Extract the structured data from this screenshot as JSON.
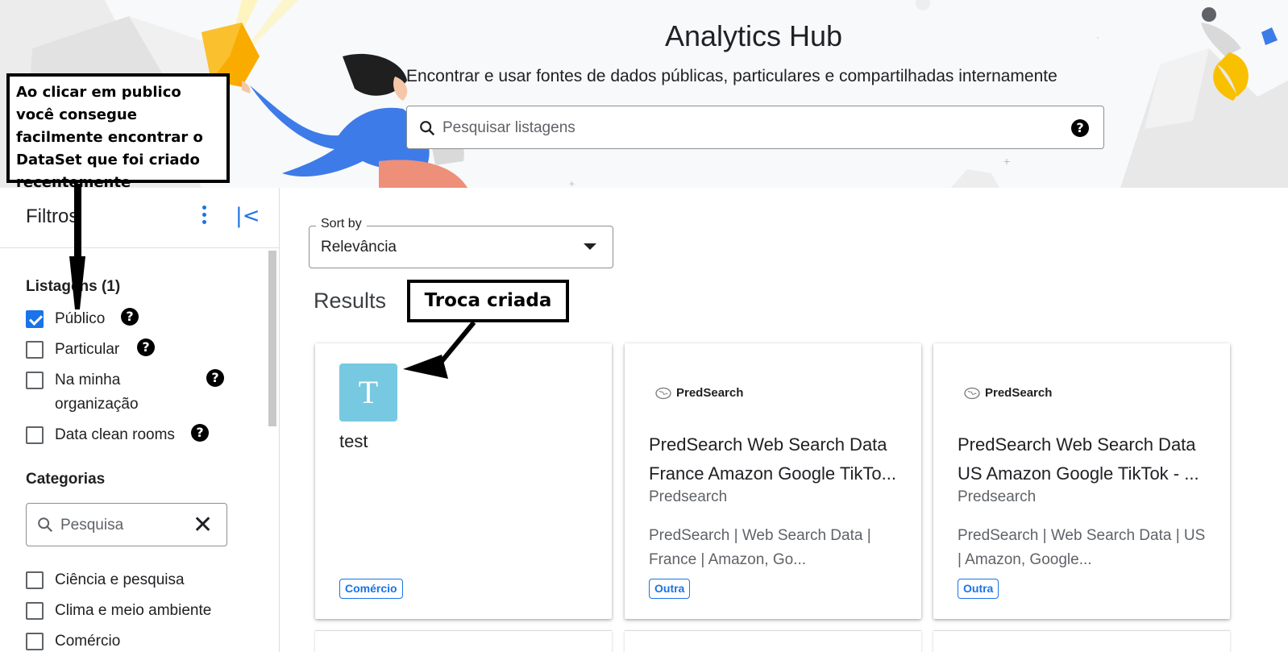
{
  "header": {
    "title": "Analytics Hub",
    "subtitle": "Encontrar e usar fontes de dados públicas, particulares e compartilhadas internamente",
    "search_placeholder": "Pesquisar listagens"
  },
  "sidebar": {
    "title": "Filtros",
    "listings_title": "Listagens (1)",
    "listings": [
      {
        "label": "Público",
        "checked": true
      },
      {
        "label": "Particular",
        "checked": false
      },
      {
        "label": "Na minha organização",
        "checked": false
      },
      {
        "label": "Data clean rooms",
        "checked": false
      }
    ],
    "categories_title": "Categorias",
    "category_search_placeholder": "Pesquisa",
    "categories": [
      {
        "label": "Ciência e pesquisa",
        "checked": false
      },
      {
        "label": "Clima e meio ambiente",
        "checked": false
      },
      {
        "label": "Comércio",
        "checked": false
      }
    ]
  },
  "main": {
    "sort_label": "Sort by",
    "sort_value": "Relevância",
    "results_title": "Results",
    "cards": [
      {
        "logo_letter": "T",
        "title": "test",
        "provider": "",
        "description": "",
        "tag": "Comércio"
      },
      {
        "brand": "PredSearch",
        "title": "PredSearch Web Search Data France Amazon Google TikTo...",
        "provider": "Predsearch",
        "description": "PredSearch | Web Search Data | France | Amazon, Go...",
        "tag": "Outra"
      },
      {
        "brand": "PredSearch",
        "title": "PredSearch Web Search Data US Amazon Google TikTok - ...",
        "provider": "Predsearch",
        "description": "PredSearch | Web Search Data | US | Amazon, Google...",
        "tag": "Outra"
      }
    ]
  },
  "annotations": {
    "public_note": "Ao clicar em publico você consegue facilmente encontrar o DataSet que foi criado recentemente",
    "exchange_note": "Troca criada"
  },
  "colors": {
    "accent": "#1a73e8",
    "logo_tile": "#76c9e0",
    "hero_bg": "#f8f9fa"
  }
}
